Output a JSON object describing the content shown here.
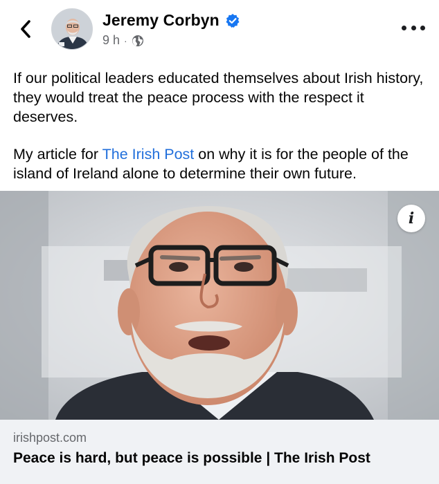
{
  "post": {
    "author": "Jeremy Corbyn",
    "time": "9 h",
    "separator": "·",
    "verified_icon": "verified-badge-icon",
    "privacy_icon": "globe-icon",
    "paragraph1": "If our political leaders educated themselves about Irish history, they would treat the peace process with the respect it deserves.",
    "paragraph2_before": "My article for ",
    "paragraph2_link": "The Irish Post",
    "paragraph2_after": " on why it is for the people of the island of Ireland alone to determine their own future."
  },
  "link_preview": {
    "domain": "irishpost.com",
    "headline": "Peace is hard, but peace is possible | The Irish Post",
    "info_label": "i"
  },
  "colors": {
    "link": "#216fdb",
    "verified": "#1877f2",
    "meta": "#65676b",
    "card_bg": "#f0f2f5"
  }
}
